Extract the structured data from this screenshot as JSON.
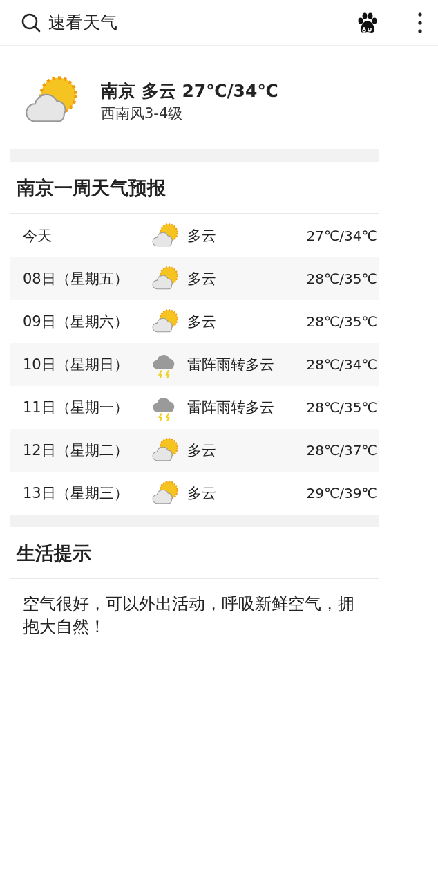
{
  "top_bar": {
    "title": "速看天气"
  },
  "current": {
    "kind": "cloudy",
    "headline": "南京 多云 27℃/34℃",
    "wind": "西南风3-4级"
  },
  "forecast": {
    "title": "南京一周天气预报",
    "rows": [
      {
        "date": "今天",
        "kind": "cloudy",
        "weather": "多云",
        "temp": "27℃/34℃"
      },
      {
        "date": "08日（星期五）",
        "kind": "cloudy",
        "weather": "多云",
        "temp": "28℃/35℃"
      },
      {
        "date": "09日（星期六）",
        "kind": "cloudy",
        "weather": "多云",
        "temp": "28℃/35℃"
      },
      {
        "date": "10日（星期日）",
        "kind": "thunderstorm",
        "weather": "雷阵雨转多云",
        "temp": "28℃/34℃"
      },
      {
        "date": "11日（星期一）",
        "kind": "thunderstorm",
        "weather": "雷阵雨转多云",
        "temp": "28℃/35℃"
      },
      {
        "date": "12日（星期二）",
        "kind": "cloudy",
        "weather": "多云",
        "temp": "28℃/37℃"
      },
      {
        "date": "13日（星期三）",
        "kind": "cloudy",
        "weather": "多云",
        "temp": "29℃/39℃"
      }
    ]
  },
  "tips": {
    "title": "生活提示",
    "text": "空气很好，可以外出活动，呼吸新鲜空气，拥抱大自然！"
  }
}
